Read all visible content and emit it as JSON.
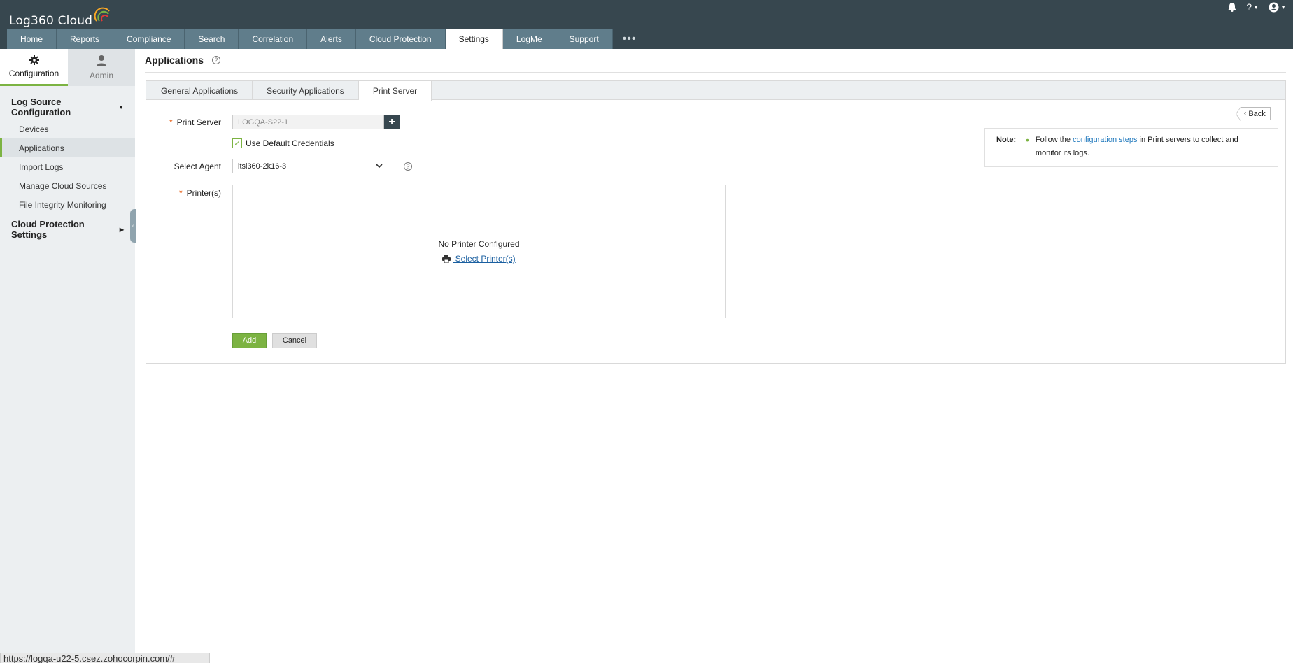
{
  "header": {
    "logo_text": "Log360 Cloud",
    "nav_tabs": [
      "Home",
      "Reports",
      "Compliance",
      "Search",
      "Correlation",
      "Alerts",
      "Cloud Protection",
      "Settings",
      "LogMe",
      "Support"
    ],
    "active_tab": "Settings",
    "more_label": "•••"
  },
  "sidebar": {
    "tabs": [
      {
        "label": "Configuration",
        "icon": "gear-icon"
      },
      {
        "label": "Admin",
        "icon": "user-icon"
      }
    ],
    "section1": "Log Source Configuration",
    "items": [
      "Devices",
      "Applications",
      "Import Logs",
      "Manage Cloud Sources",
      "File Integrity Monitoring"
    ],
    "active_item": "Applications",
    "section2": "Cloud Protection Settings"
  },
  "page": {
    "title": "Applications",
    "tabs": [
      "General Applications",
      "Security Applications",
      "Print Server"
    ],
    "active_tab": "Print Server"
  },
  "form": {
    "print_server_label": "Print Server",
    "print_server_value": "LOGQA-S22-1",
    "default_credentials_label": "Use Default Credentials",
    "default_credentials_checked": true,
    "select_agent_label": "Select Agent",
    "select_agent_value": "itsl360-2k16-3",
    "printers_label": "Printer(s)",
    "no_printer_text": "No Printer Configured",
    "select_printer_link": " Select Printer(s)",
    "add_button": "Add",
    "cancel_button": "Cancel"
  },
  "back_button": "Back",
  "note": {
    "label": "Note:",
    "text_before": "Follow the ",
    "link_text": "configuration steps",
    "text_after": " in Print servers to collect and monitor its logs."
  },
  "status_url": "https://logqa-u22-5.csez.zohocorpin.com/#"
}
